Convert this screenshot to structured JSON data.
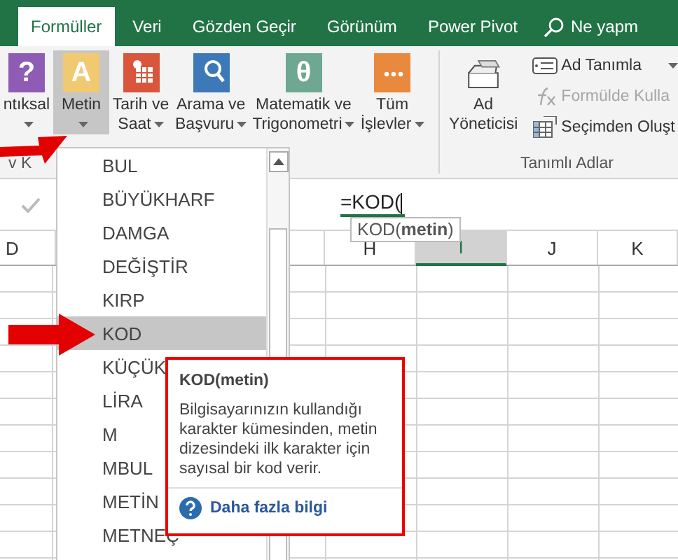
{
  "tabs": [
    {
      "label": "Formüller",
      "selected": true
    },
    {
      "label": "Veri",
      "selected": false
    },
    {
      "label": "Gözden Geçir",
      "selected": false
    },
    {
      "label": "Görünüm",
      "selected": false
    },
    {
      "label": "Power Pivot",
      "selected": false
    }
  ],
  "tell_me": {
    "label": "Ne yapm"
  },
  "ribbon": {
    "function_library": {
      "label": "v K",
      "buttons": [
        {
          "kind": "logical",
          "glyph": "?",
          "lines": [
            "ntıksal"
          ],
          "dropdown": true,
          "selected": false
        },
        {
          "kind": "text",
          "glyph": "A",
          "lines": [
            "Metin"
          ],
          "dropdown": true,
          "selected": true
        },
        {
          "kind": "datetime",
          "lines": [
            "Tarih ve",
            "Saat"
          ],
          "dropdown": true,
          "selected": false
        },
        {
          "kind": "lookup",
          "lines": [
            "Arama ve",
            "Başvuru"
          ],
          "dropdown": true,
          "selected": false
        },
        {
          "kind": "math",
          "glyph": "θ",
          "lines": [
            "Matematik ve",
            "Trigonometri"
          ],
          "dropdown": true,
          "selected": false
        },
        {
          "kind": "more",
          "lines": [
            "Tüm",
            "İşlevler"
          ],
          "dropdown": true,
          "selected": false
        }
      ]
    },
    "defined_names": {
      "label": "Tanımlı Adlar",
      "name_manager": {
        "lines": [
          "Ad",
          "Yöneticisi"
        ]
      },
      "commands": [
        {
          "kind": "define",
          "label": "Ad Tanımla",
          "dropdown": true,
          "disabled": false
        },
        {
          "kind": "use",
          "label": "Formülde Kulla",
          "disabled": true
        },
        {
          "kind": "create",
          "label": "Seçimden Oluşt",
          "disabled": false
        }
      ]
    }
  },
  "formula_bar": {
    "value": "=KOD(",
    "hint": "KOD(**metin**)"
  },
  "columns": [
    {
      "label": "D",
      "selected": false
    },
    {
      "label": "H",
      "selected": false
    },
    {
      "label": "I",
      "selected": true
    },
    {
      "label": "J",
      "selected": false
    },
    {
      "label": "K",
      "selected": false
    }
  ],
  "function_menu": {
    "items": [
      {
        "label": "BUL",
        "selected": false
      },
      {
        "label": "BÜYÜKHARF",
        "selected": false
      },
      {
        "label": "DAMGA",
        "selected": false
      },
      {
        "label": "DEĞİŞTİR",
        "selected": false
      },
      {
        "label": "KIRP",
        "selected": false
      },
      {
        "label": "KOD",
        "selected": true
      },
      {
        "label": "KÜÇÜK",
        "selected": false
      },
      {
        "label": "LİRA",
        "selected": false
      },
      {
        "label": "M",
        "selected": false
      },
      {
        "label": "MBUL",
        "selected": false
      },
      {
        "label": "METİN",
        "selected": false
      },
      {
        "label": "METNEÇ",
        "selected": false
      }
    ]
  },
  "tooltip": {
    "title": "KOD(metin)",
    "description": "Bilgisayarınızın kullandığı karakter kümesinden, metin dizesindeki ilk karakter için sayısal bir kod verir.",
    "link": "Daha fazla bilgi"
  }
}
